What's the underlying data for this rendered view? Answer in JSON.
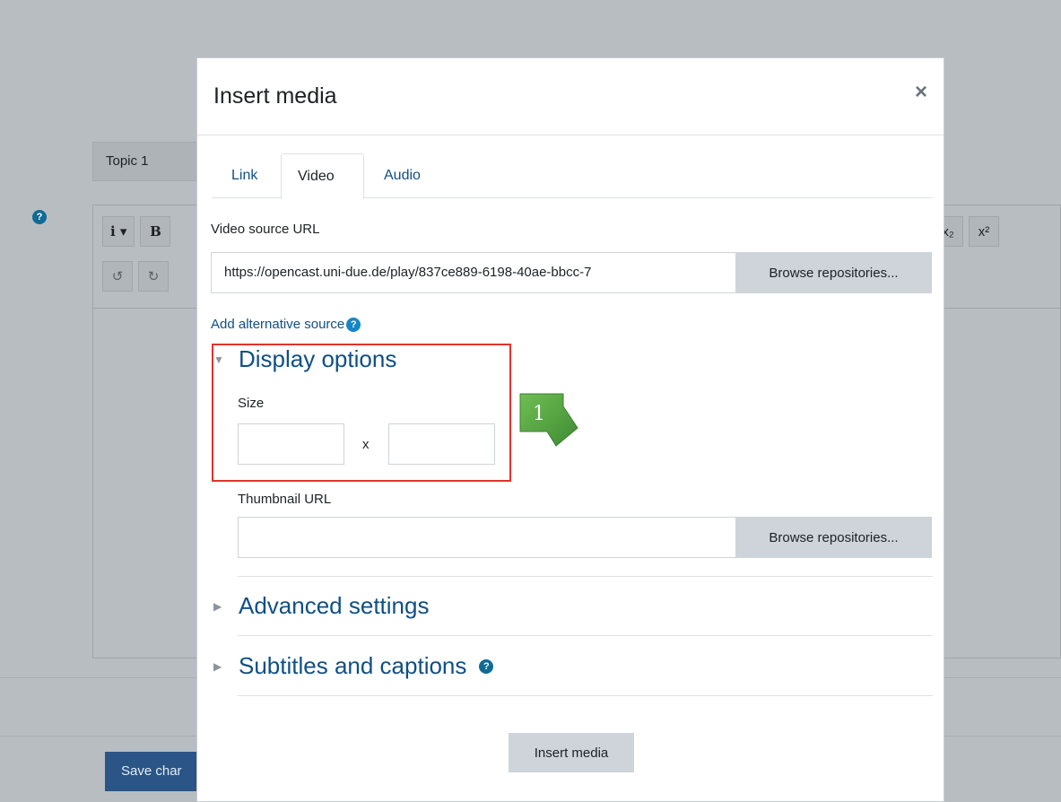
{
  "background": {
    "topic_label": "Topic 1",
    "help_glyph": "?",
    "toolbar_row1": [
      "i ▾",
      "B"
    ],
    "toolbar_row2": [
      "↺",
      "↻"
    ],
    "toolbar_right": [
      "x₂",
      "x²"
    ],
    "save_label": "Save char"
  },
  "modal": {
    "title": "Insert media",
    "close_glyph": "×",
    "tabs": [
      {
        "label": "Link"
      },
      {
        "label": "Video"
      },
      {
        "label": "Audio"
      }
    ],
    "active_tab": "Video",
    "video_source_label": "Video source URL",
    "video_source_value": "https://opencast.uni-due.de/play/837ce889-6198-40ae-bbcc-7",
    "browse_label": "Browse repositories...",
    "add_alternative_source": "Add alternative source",
    "help_glyph": "?",
    "display_options": {
      "title": "Display options",
      "size_label": "Size",
      "size_separator": "x",
      "thumbnail_label": "Thumbnail URL",
      "browse_label": "Browse repositories..."
    },
    "advanced_settings": "Advanced settings",
    "subtitles": "Subtitles and captions",
    "insert_button": "Insert media"
  },
  "annotation": {
    "number": "1",
    "color": "#5aa545",
    "highlight_color": "#e0332c"
  }
}
